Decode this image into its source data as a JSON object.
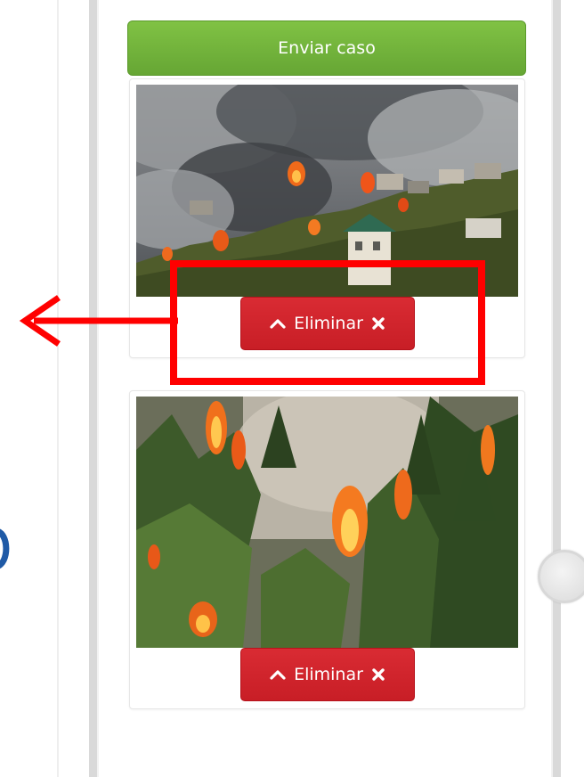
{
  "form": {
    "submit_label": "Enviar caso"
  },
  "photos": [
    {
      "delete_label": "Eliminar",
      "icon_left": "chevron-up-icon",
      "icon_right": "times-icon"
    },
    {
      "delete_label": "Eliminar",
      "icon_left": "chevron-up-icon",
      "icon_right": "times-icon"
    }
  ],
  "colors": {
    "submit_green": "#6aad38",
    "delete_red": "#d0232c",
    "annotation_red": "#ff0000",
    "side_glyph_blue": "#1f5aa6"
  }
}
